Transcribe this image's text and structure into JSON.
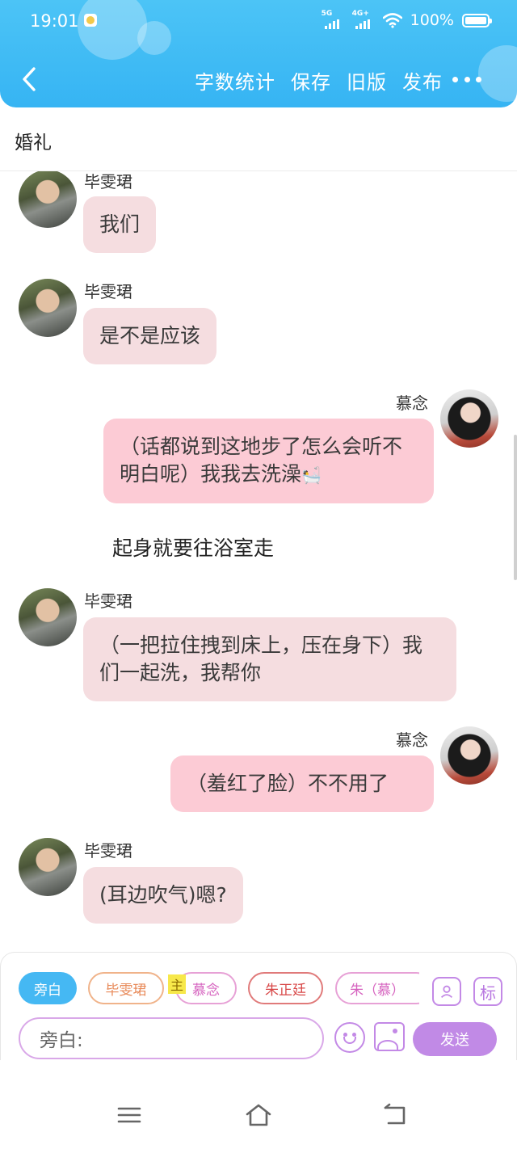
{
  "status_bar": {
    "time": "19:01",
    "net1": "5G",
    "net2": "4G+",
    "battery": "100%"
  },
  "header": {
    "actions": [
      "字数统计",
      "保存",
      "旧版",
      "发布"
    ],
    "title": "婚礼"
  },
  "chat": {
    "messages": [
      {
        "side": "left",
        "name": "毕雯珺",
        "text": "我们"
      },
      {
        "side": "left",
        "name": "毕雯珺",
        "text": "是不是应该"
      },
      {
        "side": "right",
        "name": "慕念",
        "text": "（话都说到这地步了怎么会听不明白呢）我我去洗澡",
        "emoji": "🛀"
      },
      {
        "side": "narration",
        "text": "起身就要往浴室走"
      },
      {
        "side": "left",
        "name": "毕雯珺",
        "text": "（一把拉住拽到床上，压在身下）我们一起洗，我帮你"
      },
      {
        "side": "right",
        "name": "慕念",
        "text": "（羞红了脸）不不用了"
      },
      {
        "side": "left",
        "name": "毕雯珺",
        "text": "(耳边吹气)嗯?"
      }
    ]
  },
  "composer": {
    "chips": [
      "旁白",
      "毕雯珺",
      "慕念",
      "朱正廷",
      "朱（慕）"
    ],
    "lead_badge": "主",
    "mark_icon_label": "标",
    "input_placeholder": "旁白:",
    "send_label": "发送"
  },
  "colors": {
    "header_blue": "#3fbcf5",
    "left_bubble": "#f5dde0",
    "right_bubble": "#fccbd5",
    "accent_purple": "#c18ae6"
  },
  "icons": [
    "back-arrow-icon",
    "more-dots-icon",
    "wifi-icon",
    "battery-icon",
    "person-card-icon",
    "emoji-icon",
    "image-icon",
    "menu-icon",
    "home-icon",
    "back-icon"
  ]
}
